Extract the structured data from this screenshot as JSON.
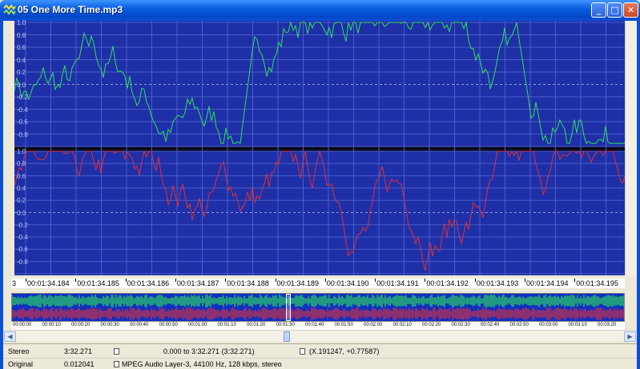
{
  "window": {
    "title": "05 One More Time.mp3"
  },
  "waveform": {
    "amplitude_labels_top": [
      "1.0",
      "0.8",
      "0.6",
      "0.4",
      "0.2",
      "0.0",
      "-0.2",
      "-0.4",
      "-0.6",
      "-0.8"
    ],
    "amplitude_labels_bottom": [
      "1.0",
      "0.8",
      "0.6",
      "0.4",
      "0.2",
      "0.0",
      "-0.2",
      "-0.4",
      "-0.6",
      "-0.8"
    ],
    "left_channel_color": "#2ee05a",
    "right_channel_color": "#e0303a",
    "background_color": "#1e2fa8"
  },
  "ruler": {
    "first_tick": "3",
    "labels": [
      "00:01:34.184",
      "00:01:34.185",
      "00:01:34.186",
      "00:01:34.187",
      "00:01:34.188",
      "00:01:34.189",
      "00:01:34.190",
      "00:01:34.191",
      "00:01:34.192",
      "00:01:34.193",
      "00:01:34.194",
      "00:01:34.195"
    ]
  },
  "overview_ruler": {
    "labels": [
      "00:00:00",
      "00:00:10",
      "00:00:20",
      "00:00:30",
      "00:00:40",
      "00:00:50",
      "00:01:00",
      "00:01:10",
      "00:01:20",
      "00:01:30",
      "00:01:40",
      "00:01:50",
      "00:02:00",
      "00:02:10",
      "00:02:20",
      "00:02:30",
      "00:02:40",
      "00:02:50",
      "00:03:00",
      "00:03:10",
      "00:03:20"
    ]
  },
  "status": {
    "channels": "Stereo",
    "duration": "3:32.271",
    "selection": "0.000 to 3:32.271 (3:32.271)",
    "cursor": "(X.191247, +0.77587)",
    "view": "Original",
    "zoom": "0.012041",
    "format": "MPEG Audio Layer-3, 44100 Hz, 128 kbps, stereo"
  }
}
